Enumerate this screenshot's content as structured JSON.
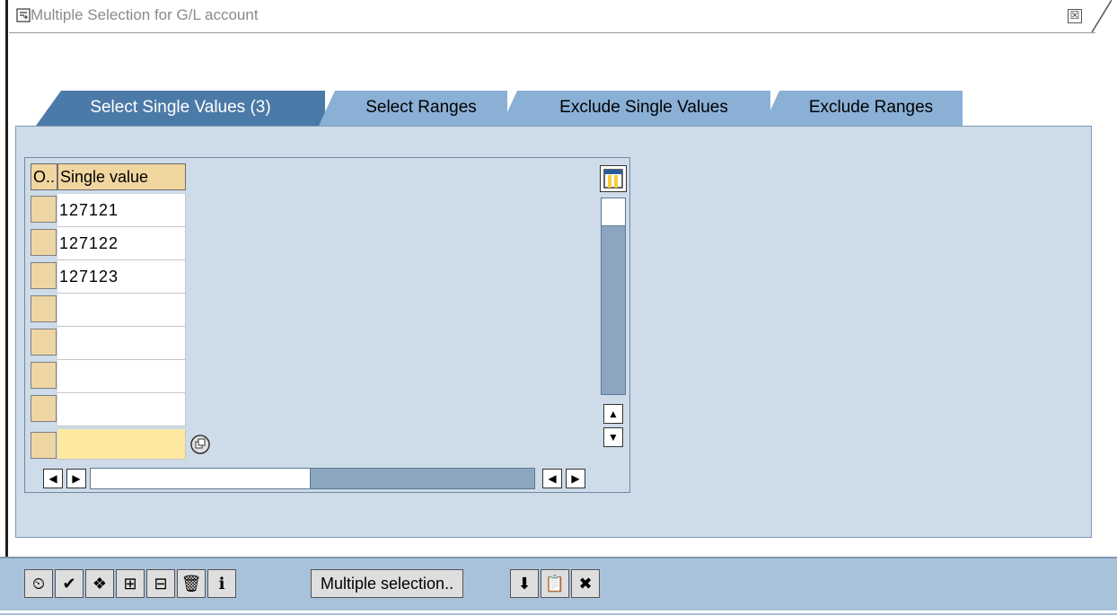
{
  "window": {
    "title": "Multiple Selection for G/L account",
    "close_glyph": "☒"
  },
  "tabs": [
    {
      "label": "Select Single Values (3)",
      "active": true
    },
    {
      "label": "Select Ranges",
      "active": false
    },
    {
      "label": "Exclude Single Values",
      "active": false
    },
    {
      "label": "Exclude Ranges",
      "active": false
    }
  ],
  "table": {
    "columns": [
      "O..",
      "Single value"
    ],
    "rows": [
      "127121",
      "127122",
      "127123",
      "",
      "",
      "",
      ""
    ],
    "active_row_value": ""
  },
  "toolbar": {
    "buttons": [
      {
        "icon": "clock-icon",
        "glyph": "⏲"
      },
      {
        "icon": "checkmark-icon",
        "glyph": "✔"
      },
      {
        "icon": "execute-icon",
        "glyph": "❖"
      },
      {
        "icon": "insert-line-icon",
        "glyph": "⊞"
      },
      {
        "icon": "delete-line-icon",
        "glyph": "⊟"
      },
      {
        "icon": "trash-icon",
        "glyph": "🗑"
      },
      {
        "icon": "info-icon",
        "glyph": "ℹ"
      }
    ],
    "multiple_selection_label": "Multiple selection..",
    "right_buttons": [
      {
        "icon": "upload-icon",
        "glyph": "⬇"
      },
      {
        "icon": "clipboard-icon",
        "glyph": "📋"
      },
      {
        "icon": "cancel-icon",
        "glyph": "✖"
      }
    ]
  },
  "colors": {
    "panel": "#cedbe8",
    "tab_active": "#4c7aa8",
    "tab_inactive": "#8ab0d6",
    "footer": "#a9c2dc",
    "header_cell": "#f1d6a0"
  }
}
